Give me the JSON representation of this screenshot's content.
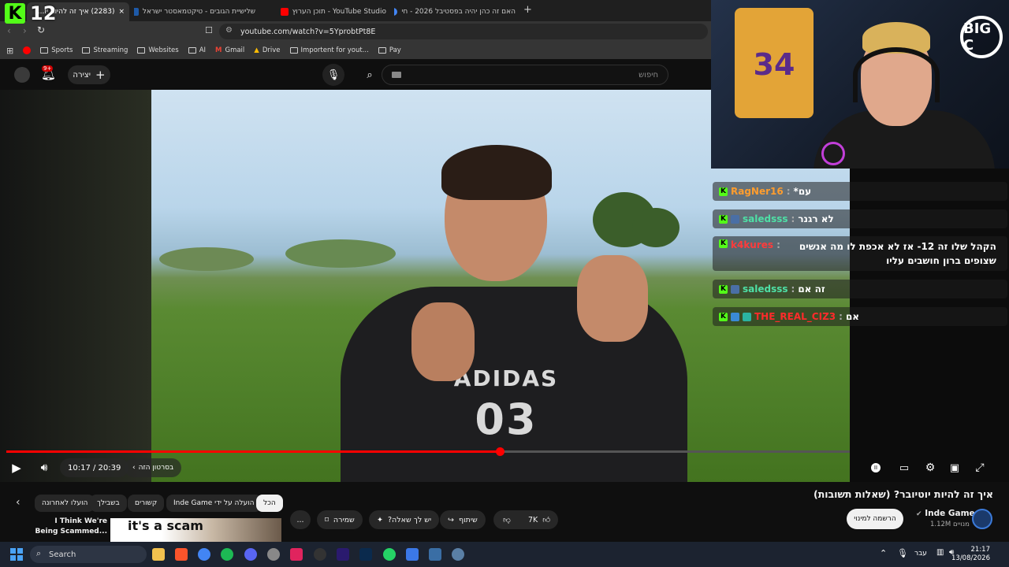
{
  "browser": {
    "tabs": [
      {
        "title": "(2283) איך זה להיות יו...",
        "favicon_color": "#ff0000",
        "active": true
      },
      {
        "title": "שלישיית הגובים - טיקטמאסטר ישראל",
        "favicon_color": "#1e5aa8",
        "active": false
      },
      {
        "title": "YouTube Studio - תוכן הערוץ",
        "favicon_color": "#ff0000",
        "active": false
      },
      {
        "title": "האם זה כהן יהיה בפסטיבל 2026 - חי",
        "favicon_color": "#4285f4",
        "active": false
      }
    ],
    "url": "youtube.com/watch?v=5YprobtPt8E",
    "bookmarks": [
      "Sports",
      "Streaming",
      "Websites",
      "AI",
      "Gmail",
      "Drive",
      "Importent for yout...",
      "Pay"
    ]
  },
  "youtube_header": {
    "search_placeholder": "חיפוש",
    "create_label": "יצירה",
    "notification_count": "9+"
  },
  "stream_overlay": {
    "viewer_count": "12",
    "kick_logo": "K",
    "webcam_badge": "BIG C",
    "jersey_number": "34",
    "chat": [
      {
        "user": "RagNer16",
        "user_color": "#ff9d2e",
        "text": "עם*"
      },
      {
        "user": "saledsss",
        "user_color": "#4ee0a6",
        "text": "לא רגנר"
      },
      {
        "user": "k4kures",
        "user_color": "#ff3b3b",
        "text": "הקהל שלו זה 12- אז לא אכפת לו מה אנשים שצופים ברון חושבים עליו"
      },
      {
        "user": "saledsss",
        "user_color": "#4ee0a6",
        "text": "זה אם"
      },
      {
        "user": "THE_REAL_CIZ3",
        "user_color": "#ff2b2b",
        "text": "אם"
      }
    ]
  },
  "video": {
    "shirt_text": "ADIDAS",
    "shirt_number": "03",
    "current_time": "10:17",
    "duration": "20:39",
    "time_display": "10:17 / 20:39",
    "chapter_label": "בסרטון הזה",
    "progress": 0.585
  },
  "below_video": {
    "title": "איך זה להיות יוטיובר? (שאלות תשובות)",
    "channel_name": "Inde Game",
    "subscribers": "1.12M מנויים",
    "subscribe_label": "הרשמה למינוי",
    "like_count": "7K",
    "share_label": "שיתוף",
    "ask_label": "יש לך שאלה?",
    "save_label": "שמירה",
    "more_label": "...",
    "chips": [
      "הכל",
      "הועלה על ידי Inde Game",
      "קשורים",
      "בשבילך",
      "הועלו לאחרונה"
    ],
    "recommended": {
      "title": "I Think We're Being Scammed...",
      "thumb_text": "it's a scam"
    }
  },
  "taskbar": {
    "search_label": "Search",
    "language": "עבר",
    "time": "21:17",
    "date": "13/08/2026"
  }
}
